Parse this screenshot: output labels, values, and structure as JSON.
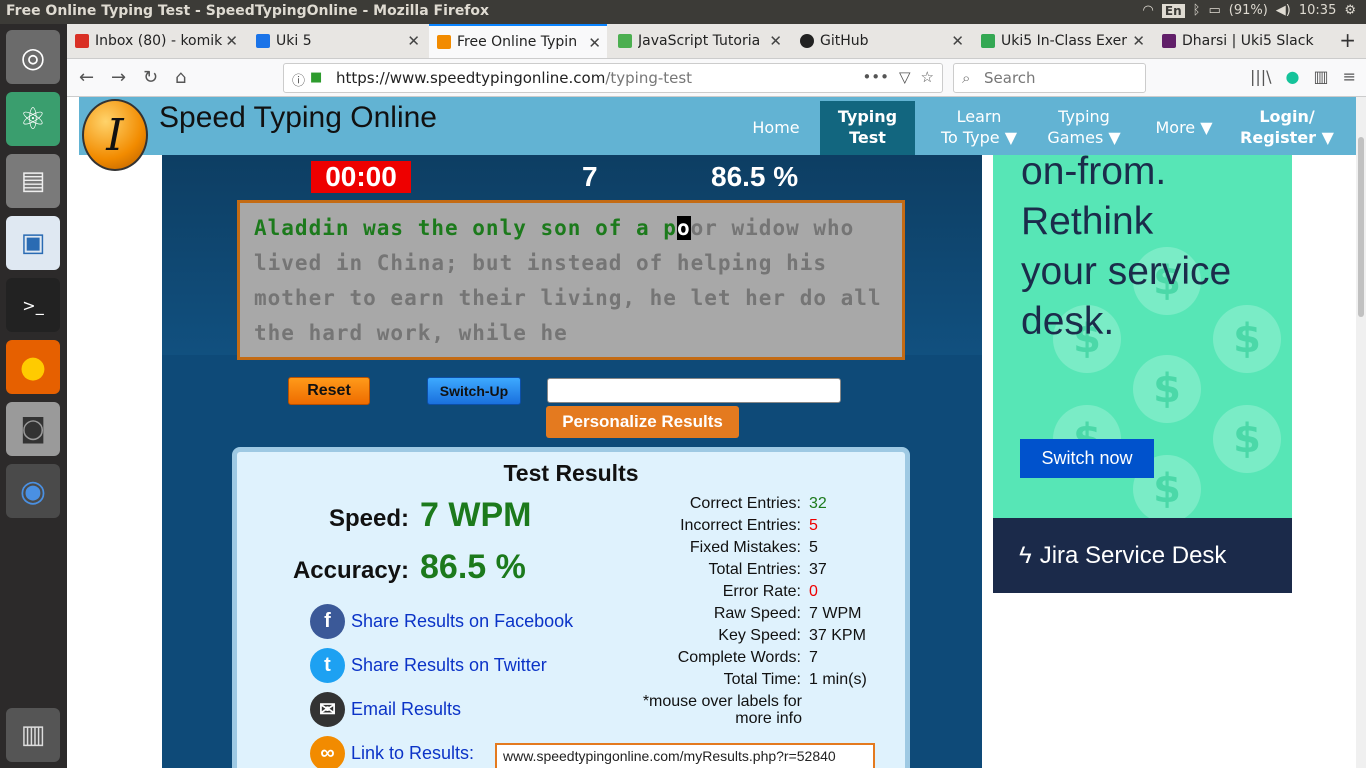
{
  "window": {
    "title": "Free Online Typing Test - SpeedTypingOnline - Mozilla Firefox"
  },
  "tray": {
    "lang": "En",
    "battery": "(91%)",
    "time": "10:35"
  },
  "tabs": [
    {
      "label": "Inbox (80) - komik",
      "color": "#d93025"
    },
    {
      "label": "Uki 5",
      "color": "#1a73e8"
    },
    {
      "label": "Free Online Typin",
      "color": "#f28b00"
    },
    {
      "label": "JavaScript Tutoria",
      "color": "#4caf50"
    },
    {
      "label": "GitHub",
      "color": "#222222"
    },
    {
      "label": "Uki5 In-Class Exer",
      "color": "#34a853"
    },
    {
      "label": "Dharsi | Uki5 Slack",
      "color": "#611f69"
    }
  ],
  "url": {
    "host": "https://www.speedtypingonline.com",
    "path": "/typing-test"
  },
  "search": {
    "placeholder": "Search"
  },
  "site": {
    "title": "Speed Typing Online",
    "menu": {
      "home": "Home",
      "typing_test": "Typing\nTest",
      "learn": "Learn\nTo Type ▼",
      "games": "Typing\nGames ▼",
      "more": "More ▼",
      "login": "Login/\nRegister ▼"
    }
  },
  "test": {
    "timer": "00:00",
    "wpm": "7",
    "accuracy": "86.5 %",
    "text_typed": "Aladdin was the only son of a p",
    "text_cursor": "o",
    "text_rest": "or widow who lived in China; but instead of helping his mother to earn their living, he let her do all the hard work, while he",
    "reset": "Reset",
    "switch_up": "Switch-Up",
    "personalize": "Personalize Results"
  },
  "results": {
    "title": "Test Results",
    "speed_label": "Speed:",
    "speed_value": "7 WPM",
    "accuracy_label": "Accuracy:",
    "accuracy_value": "86.5 %",
    "share_facebook": "Share Results on Facebook",
    "share_twitter": "Share Results on Twitter",
    "email": "Email Results",
    "link_label": "Link to Results:",
    "link_url": "www.speedtypingonline.com/myResults.php?r=52840",
    "stats": [
      {
        "label": "Correct Entries:",
        "value": "32",
        "tone": "g"
      },
      {
        "label": "Incorrect Entries:",
        "value": "5",
        "tone": "r"
      },
      {
        "label": "Fixed Mistakes:",
        "value": "5",
        "tone": ""
      },
      {
        "label": "Total Entries:",
        "value": "37",
        "tone": ""
      },
      {
        "label": "Error Rate:",
        "value": "0",
        "tone": "r"
      },
      {
        "label": "Raw Speed:",
        "value": "7 WPM",
        "tone": ""
      },
      {
        "label": "Key Speed:",
        "value": "37 KPM",
        "tone": ""
      },
      {
        "label": "Complete Words:",
        "value": "7",
        "tone": ""
      },
      {
        "label": "Total Time:",
        "value": "1 min(s)",
        "tone": ""
      }
    ],
    "note": "*mouse over labels for more info"
  },
  "ad": {
    "headline": "on-from.\nRethink\nyour service\ndesk.",
    "button": "Switch now",
    "brand": "Jira Service Desk"
  }
}
